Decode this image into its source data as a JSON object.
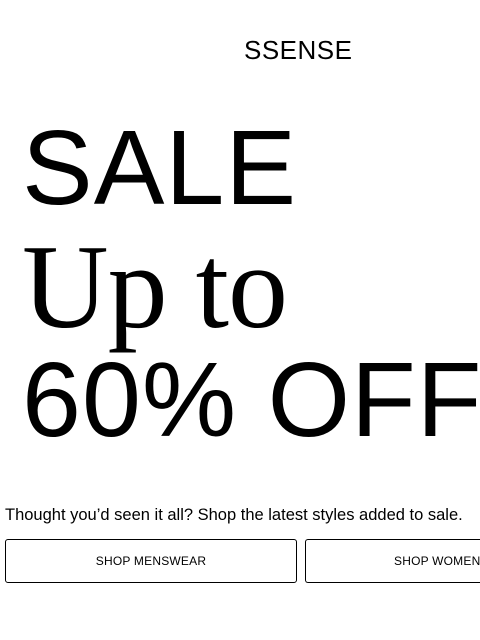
{
  "header": {
    "logo_text": "SSENSE"
  },
  "hero": {
    "line1": "SALE",
    "line2": "Up to",
    "line3": "60% OFF"
  },
  "promo": {
    "tagline": "Thought you’d seen it all? Shop the latest styles added to sale."
  },
  "buttons": {
    "menswear": "SHOP MENSWEAR",
    "womenswear": "SHOP WOMENSWEAR"
  }
}
